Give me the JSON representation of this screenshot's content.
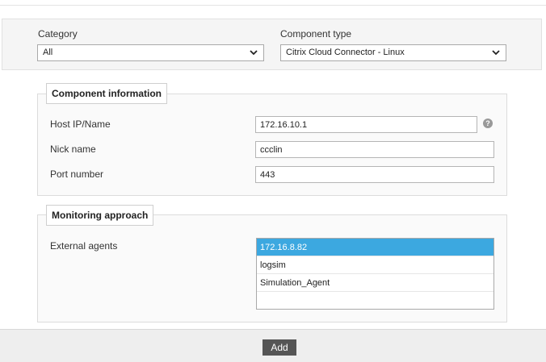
{
  "filters": {
    "category": {
      "label": "Category",
      "value": "All"
    },
    "component_type": {
      "label": "Component type",
      "value": "Citrix Cloud Connector - Linux"
    }
  },
  "component_information": {
    "legend": "Component information",
    "host_ip": {
      "label": "Host IP/Name",
      "value": "172.16.10.1"
    },
    "nick_name": {
      "label": "Nick name",
      "value": "ccclin"
    },
    "port_number": {
      "label": "Port number",
      "value": "443"
    },
    "help_icon": "?"
  },
  "monitoring_approach": {
    "legend": "Monitoring approach",
    "external_agents_label": "External agents",
    "agents": [
      "172.16.8.82",
      "logsim",
      "Simulation_Agent"
    ],
    "selected_agent": "172.16.8.82"
  },
  "footer": {
    "add_label": "Add"
  },
  "colors": {
    "selected": "#3ca8e0",
    "button": "#555555"
  }
}
